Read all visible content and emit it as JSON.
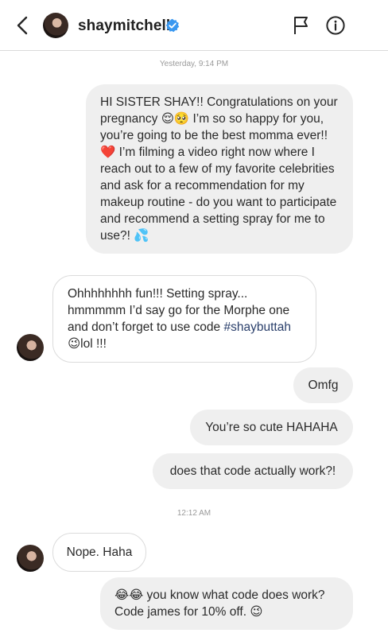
{
  "header": {
    "username": "shaymitchell"
  },
  "timestamps": {
    "first": "Yesterday, 9:14 PM",
    "second": "12:12 AM"
  },
  "messages": [
    {
      "text": "HI SISTER SHAY!! Congratulations on your pregnancy 😌🥺 I’m so so happy for you, you’re going to be the best momma ever!! ❤️ I’m filming a video right now where I reach out to a few of my favorite celebrities and ask for a recommendation for my makeup routine - do you want to participate and recommend a setting spray for me to use?! 💦"
    },
    {
      "text_a": "Ohhhhhhhh fun!!! Setting spray... hmmmmm I’d say go for the Morphe one and don’t forget to use code ",
      "hashtag": "#shaybuttah",
      "text_b": "😉lol !!!"
    },
    {
      "text": "Omfg"
    },
    {
      "text": "You’re so cute HAHAHA"
    },
    {
      "text": "does that code actually work?!"
    },
    {
      "text": "Nope. Haha"
    },
    {
      "text": "😂😂 you know what code does work? Code james for 10% off. 😉"
    }
  ],
  "icons": {
    "back": "chevron-left-icon",
    "verified": "verified-badge-icon",
    "flag": "flag-icon",
    "info": "info-icon"
  },
  "colors": {
    "outgoing_bubble": "#efefef",
    "incoming_border": "#dbdbdb",
    "verified_blue": "#3897f0"
  }
}
